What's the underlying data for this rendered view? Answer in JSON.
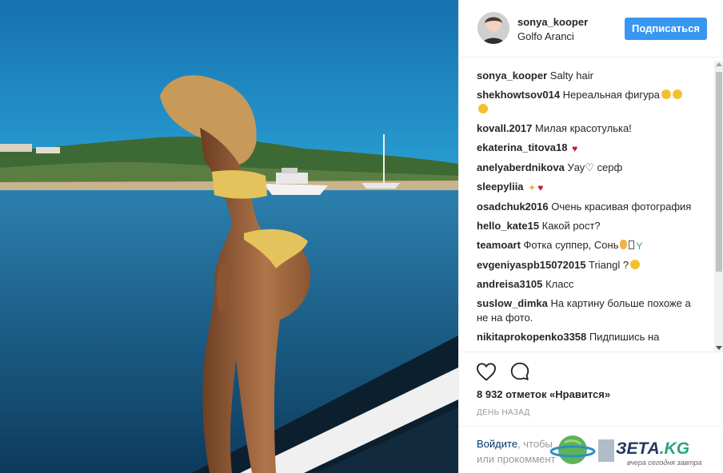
{
  "post": {
    "username": "sonya_kooper",
    "location": "Golfo Aranci",
    "follow_label": "Подписаться"
  },
  "comments": [
    {
      "user": "sonya_kooper",
      "text": "Salty hair",
      "emoji": []
    },
    {
      "user": "shekhowtsov014",
      "text": "Нереальная фигура",
      "emoji": [
        "smiling-face-heart-eyes-icon",
        "smiling-face-heart-eyes-icon",
        "smiling-face-heart-eyes-icon"
      ]
    },
    {
      "user": "kovall.2017",
      "text": "Милая красотулька!",
      "emoji": []
    },
    {
      "user": "ekaterina_titova18",
      "text": "",
      "emoji": [
        "heart-icon"
      ]
    },
    {
      "user": "anelyaberdnikova",
      "text": "Уау♡ серф",
      "emoji": []
    },
    {
      "user": "sleepyliia",
      "text": "",
      "emoji": [
        "sparkles-icon",
        "heart-icon"
      ]
    },
    {
      "user": "osadchuk2016",
      "text": "Очень красивая фотография",
      "emoji": []
    },
    {
      "user": "hello_kate15",
      "text": "Какой рост?",
      "emoji": []
    },
    {
      "user": "teamoart",
      "text": "Фотка суппер, Сонь",
      "emoji": [
        "raised-hand-icon",
        "unknown-glyph-icon",
        "cocktail-icon"
      ]
    },
    {
      "user": "evgeniyaspb15072015",
      "text": "Triangl ?",
      "emoji": [
        "smiling-face-heart-eyes-icon"
      ]
    },
    {
      "user": "andreisa3105",
      "text": "Класс",
      "emoji": []
    },
    {
      "user": "suslow_dimka",
      "text": "На картину больше похоже а не на фото.",
      "emoji": []
    },
    {
      "user": "nikitaprokopenko3358",
      "text": "Пидпишись на",
      "emoji": []
    }
  ],
  "actions": {
    "likes_text": "8 932 отметок «Нравится»",
    "time_text": "ДЕНЬ НАЗАД"
  },
  "login_prompt": {
    "login_link": "Войдите",
    "rest_line1": ", чтобы",
    "rest_line2": "или прокоммент"
  },
  "watermark": {
    "brand": "ЗЕТА",
    "tld": ".KG",
    "slogan": "вчера сегодня завтра"
  },
  "colors": {
    "accent": "#3897f0",
    "link": "#003569",
    "heart": "#c9172b",
    "sea": "#1d5f8f",
    "sky": "#1a8fc6"
  }
}
